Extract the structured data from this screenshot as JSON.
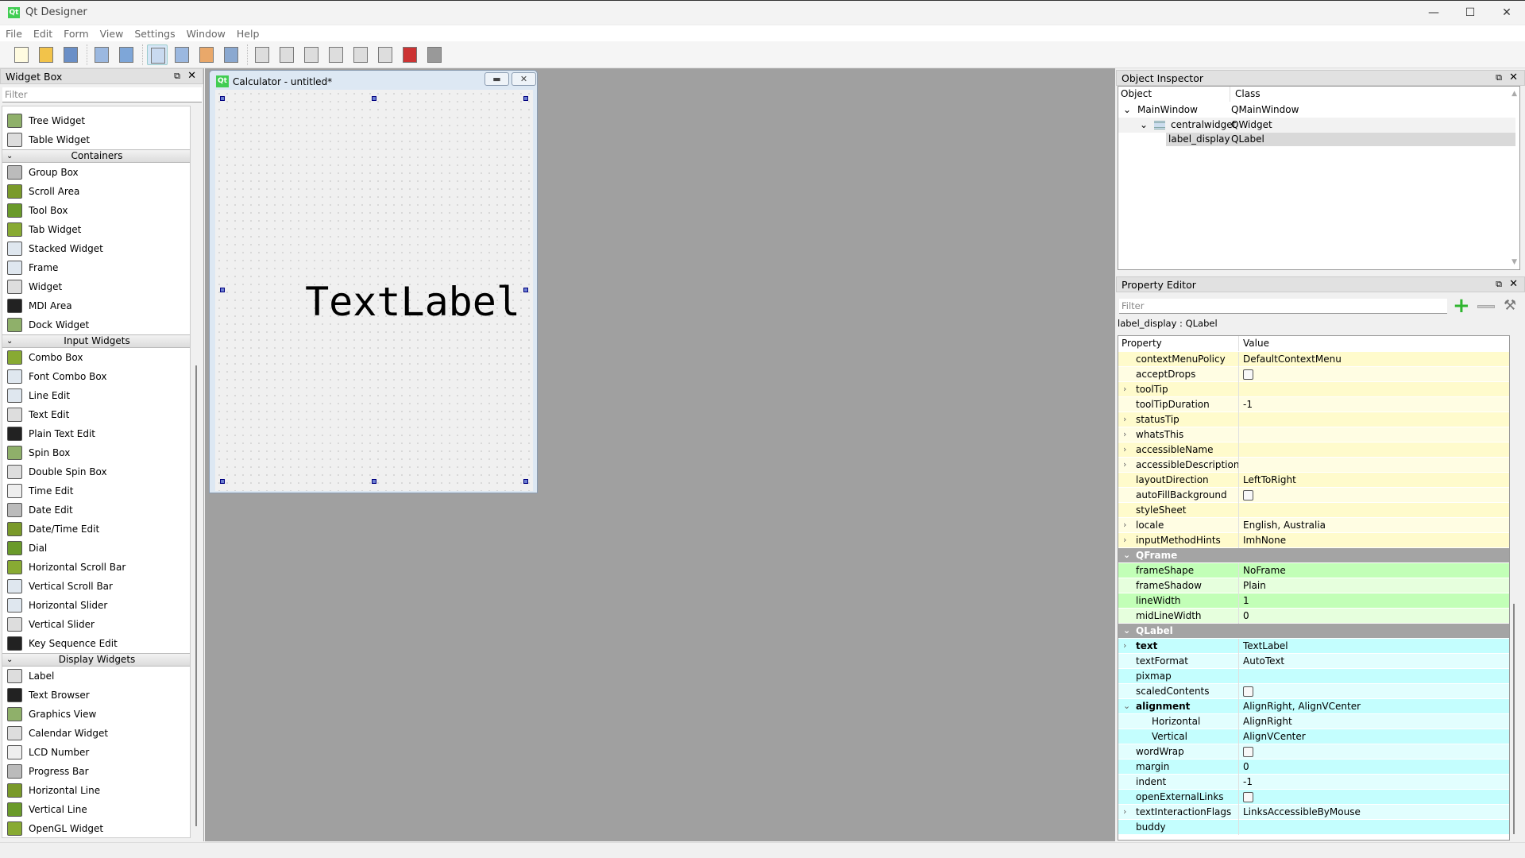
{
  "app": {
    "title": "Qt Designer",
    "logo": "Qt"
  },
  "menu": [
    "File",
    "Edit",
    "Form",
    "View",
    "Settings",
    "Window",
    "Help"
  ],
  "toolbar": [
    "new-file-icon",
    "open-folder-icon",
    "save-icon",
    "send-to-back-icon",
    "bring-to-front-icon",
    "edit-widgets-icon",
    "edit-signals-slots-icon",
    "edit-buddies-icon",
    "edit-tab-order-icon",
    "layout-horizontal-icon",
    "layout-vertical-icon",
    "layout-horizontal-splitter-icon",
    "layout-vertical-splitter-icon",
    "layout-grid-icon",
    "layout-form-icon",
    "break-layout-icon",
    "adjust-size-icon"
  ],
  "widget_box": {
    "title": "Widget Box",
    "filter_placeholder": "Filter",
    "sections": [
      {
        "category": null,
        "items": [
          "Tree Widget",
          "Table Widget"
        ]
      },
      {
        "category": "Containers",
        "items": [
          "Group Box",
          "Scroll Area",
          "Tool Box",
          "Tab Widget",
          "Stacked Widget",
          "Frame",
          "Widget",
          "MDI Area",
          "Dock Widget"
        ]
      },
      {
        "category": "Input Widgets",
        "items": [
          "Combo Box",
          "Font Combo Box",
          "Line Edit",
          "Text Edit",
          "Plain Text Edit",
          "Spin Box",
          "Double Spin Box",
          "Time Edit",
          "Date Edit",
          "Date/Time Edit",
          "Dial",
          "Horizontal Scroll Bar",
          "Vertical Scroll Bar",
          "Horizontal Slider",
          "Vertical Slider",
          "Key Sequence Edit"
        ]
      },
      {
        "category": "Display Widgets",
        "items": [
          "Label",
          "Text Browser",
          "Graphics View",
          "Calendar Widget",
          "LCD Number",
          "Progress Bar",
          "Horizontal Line",
          "Vertical Line",
          "OpenGL Widget"
        ]
      }
    ]
  },
  "form": {
    "title": "Calculator - untitled*",
    "label_text": "TextLabel"
  },
  "object_inspector": {
    "title": "Object Inspector",
    "col_object": "Object",
    "col_class": "Class",
    "rows": [
      {
        "object": "MainWindow",
        "class": "QMainWindow"
      },
      {
        "object": "centralwidget",
        "class": "QWidget"
      },
      {
        "object": "label_display",
        "class": "QLabel"
      }
    ]
  },
  "property_editor": {
    "title": "Property Editor",
    "filter_placeholder": "Filter",
    "caption": "label_display : QLabel",
    "col_property": "Property",
    "col_value": "Value",
    "colors": {
      "yellow": [
        "#fffbcc",
        "#fffde3"
      ],
      "green": [
        "#c2ffb7",
        "#e6ffdd"
      ],
      "cyan": [
        "#c4fefe",
        "#e2fefe"
      ],
      "group": "#a4a4a4"
    },
    "rows": [
      {
        "name": "contextMenuPolicy",
        "value": "DefaultContextMenu",
        "tone": "yellow"
      },
      {
        "name": "acceptDrops",
        "checkbox": false,
        "tone": "yellow"
      },
      {
        "name": "toolTip",
        "value": "",
        "expand": ">",
        "tone": "yellow"
      },
      {
        "name": "toolTipDuration",
        "value": "-1",
        "tone": "yellow"
      },
      {
        "name": "statusTip",
        "value": "",
        "expand": ">",
        "tone": "yellow"
      },
      {
        "name": "whatsThis",
        "value": "",
        "expand": ">",
        "tone": "yellow"
      },
      {
        "name": "accessibleName",
        "value": "",
        "expand": ">",
        "tone": "yellow"
      },
      {
        "name": "accessibleDescription",
        "value": "",
        "expand": ">",
        "tone": "yellow"
      },
      {
        "name": "layoutDirection",
        "value": "LeftToRight",
        "tone": "yellow"
      },
      {
        "name": "autoFillBackground",
        "checkbox": false,
        "tone": "yellow"
      },
      {
        "name": "styleSheet",
        "value": "",
        "tone": "yellow"
      },
      {
        "name": "locale",
        "value": "English, Australia",
        "expand": ">",
        "tone": "yellow"
      },
      {
        "name": "inputMethodHints",
        "value": "ImhNone",
        "expand": ">",
        "tone": "yellow"
      },
      {
        "name": "QFrame",
        "group": true
      },
      {
        "name": "frameShape",
        "value": "NoFrame",
        "tone": "green"
      },
      {
        "name": "frameShadow",
        "value": "Plain",
        "tone": "green"
      },
      {
        "name": "lineWidth",
        "value": "1",
        "tone": "green"
      },
      {
        "name": "midLineWidth",
        "value": "0",
        "tone": "green"
      },
      {
        "name": "QLabel",
        "group": true
      },
      {
        "name": "text",
        "value": "TextLabel",
        "expand": ">",
        "bold": true,
        "tone": "cyan"
      },
      {
        "name": "textFormat",
        "value": "AutoText",
        "tone": "cyan"
      },
      {
        "name": "pixmap",
        "value": "",
        "tone": "cyan"
      },
      {
        "name": "scaledContents",
        "checkbox": false,
        "tone": "cyan"
      },
      {
        "name": "alignment",
        "value": "AlignRight, AlignVCenter",
        "expand": "v",
        "bold": true,
        "tone": "cyan"
      },
      {
        "name": "Horizontal",
        "value": "AlignRight",
        "sub": true,
        "tone": "cyan"
      },
      {
        "name": "Vertical",
        "value": "AlignVCenter",
        "sub": true,
        "tone": "cyan"
      },
      {
        "name": "wordWrap",
        "checkbox": false,
        "tone": "cyan"
      },
      {
        "name": "margin",
        "value": "0",
        "tone": "cyan"
      },
      {
        "name": "indent",
        "value": "-1",
        "tone": "cyan"
      },
      {
        "name": "openExternalLinks",
        "checkbox": false,
        "tone": "cyan"
      },
      {
        "name": "textInteractionFlags",
        "value": "LinksAccessibleByMouse",
        "expand": ">",
        "tone": "cyan"
      },
      {
        "name": "buddy",
        "value": "",
        "tone": "cyan"
      }
    ]
  }
}
